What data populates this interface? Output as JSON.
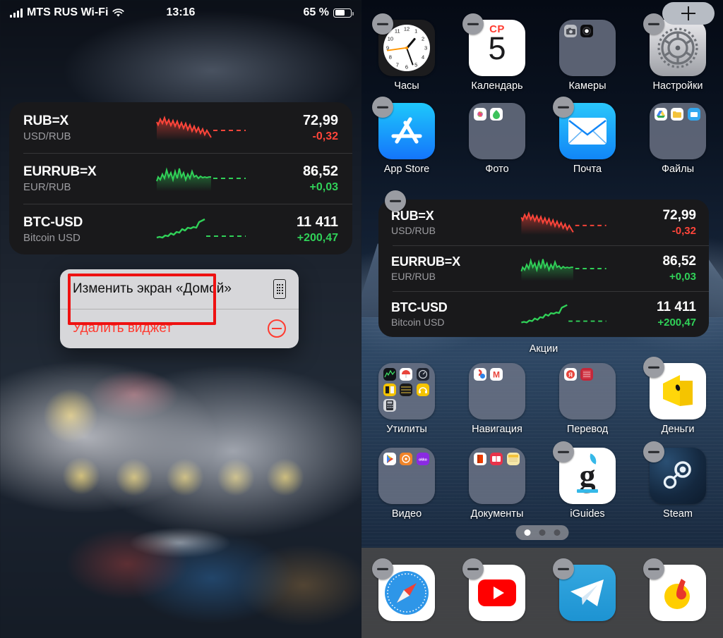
{
  "status_bar": {
    "carrier": "MTS RUS Wi-Fi",
    "signal_icon": "cellular-signal-icon",
    "wifi_icon": "wifi-icon",
    "time": "13:16",
    "battery_percent": "65 %",
    "battery_icon": "battery-icon"
  },
  "stocks_widget": {
    "label": "Акции",
    "rows": [
      {
        "symbol": "RUB=X",
        "description": "USD/RUB",
        "price": "72,99",
        "change": "-0,32",
        "direction": "down"
      },
      {
        "symbol": "EURRUB=X",
        "description": "EUR/RUB",
        "price": "86,52",
        "change": "+0,03",
        "direction": "up"
      },
      {
        "symbol": "BTC-USD",
        "description": "Bitcoin USD",
        "price": "11 411",
        "change": "+200,47",
        "direction": "up"
      }
    ],
    "colors": {
      "up": "#30d158",
      "down": "#ff453a",
      "background": "#19191b"
    }
  },
  "context_menu": {
    "items": [
      {
        "label": "Изменить экран «Домой»",
        "icon": "home-screen-phone-icon",
        "highlighted": true,
        "destructive": false
      },
      {
        "label": "Удалить виджет",
        "icon": "remove-minus-icon",
        "highlighted": false,
        "destructive": true
      }
    ],
    "highlight_color": "#ee1111"
  },
  "home_screen": {
    "add_widget_button": {
      "label": "+",
      "icon": "plus-icon"
    },
    "jiggle_badge_icon": "minus-badge-icon",
    "rows": [
      [
        {
          "label": "Часы",
          "icon": "clock-icon",
          "type": "app",
          "removable": true
        },
        {
          "label": "Календарь",
          "icon": "calendar-icon",
          "type": "app",
          "removable": true,
          "calendar_dow": "СР",
          "calendar_day": "5"
        },
        {
          "label": "Камеры",
          "icon": "folder-icon",
          "type": "folder",
          "removable": false
        },
        {
          "label": "Настройки",
          "icon": "gear-icon",
          "type": "app",
          "removable": true
        }
      ],
      [
        {
          "label": "App Store",
          "icon": "app-store-icon",
          "type": "app",
          "removable": true
        },
        {
          "label": "Фото",
          "icon": "folder-icon",
          "type": "folder",
          "removable": false
        },
        {
          "label": "Почта",
          "icon": "mail-icon",
          "type": "app",
          "removable": true
        },
        {
          "label": "Файлы",
          "icon": "folder-icon",
          "type": "folder",
          "removable": false
        }
      ],
      [
        {
          "label": "Утилиты",
          "icon": "folder-icon",
          "type": "folder",
          "removable": false
        },
        {
          "label": "Навигация",
          "icon": "folder-icon",
          "type": "folder",
          "removable": false
        },
        {
          "label": "Перевод",
          "icon": "folder-icon",
          "type": "folder",
          "removable": false
        },
        {
          "label": "Деньги",
          "icon": "wallet-icon",
          "type": "app",
          "removable": true
        }
      ],
      [
        {
          "label": "Видео",
          "icon": "folder-icon",
          "type": "folder",
          "removable": false
        },
        {
          "label": "Документы",
          "icon": "folder-icon",
          "type": "folder",
          "removable": false
        },
        {
          "label": "iGuides",
          "icon": "iguides-icon",
          "type": "app",
          "removable": true
        },
        {
          "label": "Steam",
          "icon": "steam-icon",
          "type": "app",
          "removable": true
        }
      ]
    ],
    "dock": [
      {
        "label": "",
        "icon": "safari-icon",
        "removable": true
      },
      {
        "label": "",
        "icon": "youtube-icon",
        "removable": true
      },
      {
        "label": "",
        "icon": "telegram-icon",
        "removable": true
      },
      {
        "label": "",
        "icon": "music-icon",
        "removable": true
      }
    ],
    "page_dots": {
      "count": 3,
      "active_index": 0
    }
  }
}
